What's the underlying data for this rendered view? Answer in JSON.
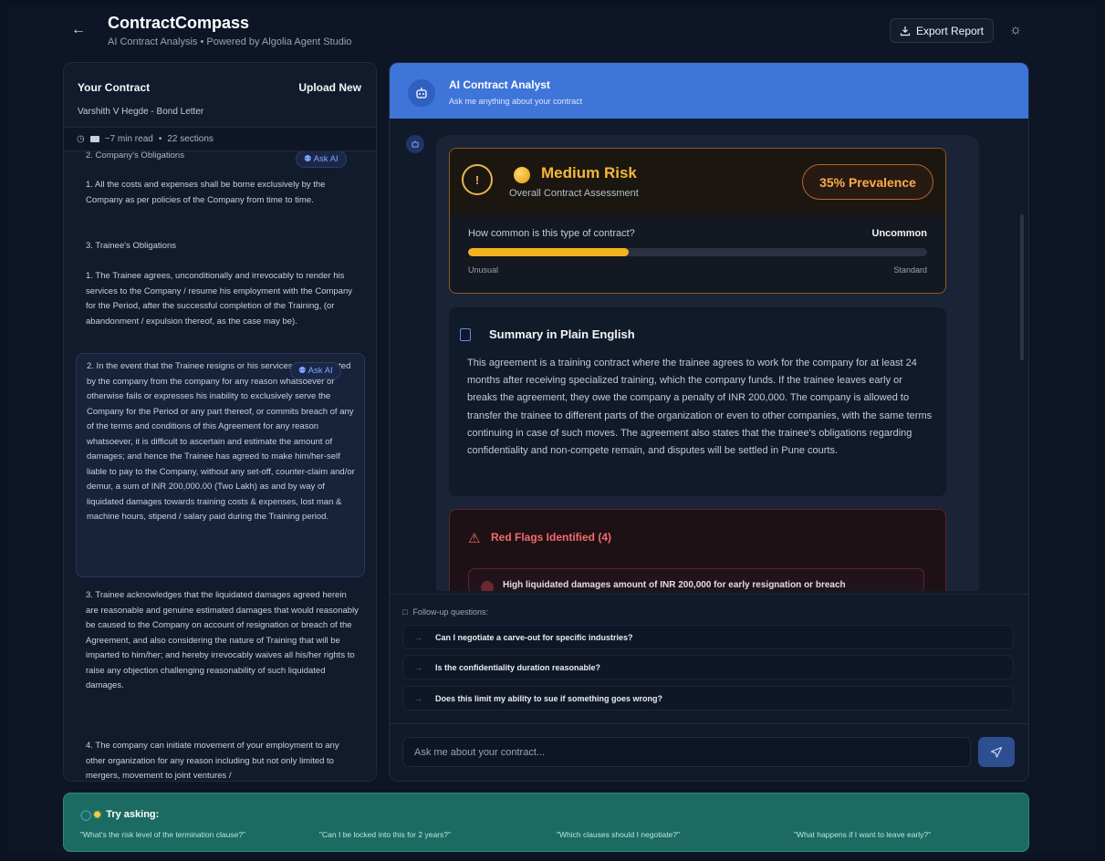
{
  "header": {
    "title": "ContractCompass",
    "subtitle": "AI Contract Analysis • Powered by Algolia Agent Studio",
    "export_label": "Export Report"
  },
  "contract_panel": {
    "title": "Your Contract",
    "upload_label": "Upload New",
    "document_name": "Varshith V Hegde - Bond Letter",
    "read_time": "~7 min read",
    "sections": "22 sections",
    "ask_ai_label": "Ask AI",
    "section_heading": "2. Company's Obligations",
    "para_costs": "1. All the costs and expenses shall be borne exclusively by the Company as per policies of the Company from time to time.",
    "heading_trainee": "3. Trainee's Obligations",
    "para_trainee_1": "1. The Trainee agrees, unconditionally and irrevocably to render his services to the Company / resume his employment with the Company for the Period, after the successful completion of the Training, (or abandonment / expulsion thereof, as the case may be).",
    "para_trainee_2": "2. In the event that the Trainee resigns or his services are terminated by the company from the company for any reason whatsoever or otherwise fails or expresses his inability to exclusively serve the Company for the Period or any part thereof, or commits breach of any of the terms and conditions of this Agreement for any reason whatsoever, it is difficult to ascertain and estimate the amount of damages; and hence the Trainee has agreed to make him/her-self liable to pay to the Company, without any set-off, counter-claim and/or demur, a sum of INR 200,000.00 (Two Lakh) as and by way of liquidated damages towards training costs & expenses, lost man & machine hours, stipend / salary paid during the Training period.",
    "para_trainee_3": "3. Trainee acknowledges that the liquidated damages agreed herein are reasonable and genuine estimated damages that would reasonably be caused to the Company on account of resignation or breach of the Agreement, and also considering the nature of Training that will be imparted to him/her; and hereby irrevocably waives all his/her rights to raise any objection challenging reasonability of such liquidated damages.",
    "para_trainee_4": "4. The company can initiate movement of your employment to any other organization for any reason including but not only limited to mergers, movement to joint ventures /"
  },
  "chat": {
    "title": "AI Contract Analyst",
    "subtitle": "Ask me anything about your contract",
    "risk": {
      "level": "Medium Risk",
      "label": "Overall Contract Assessment",
      "prevalence": "35% Prevalence",
      "question": "How common is this type of contract?",
      "answer": "Uncommon",
      "prevalence_fraction": 0.35,
      "scale_min": "Unusual",
      "scale_max": "Standard",
      "accent_color": "#f5b73a"
    },
    "summary": {
      "title": "Summary in Plain English",
      "text": "This agreement is a training contract where the trainee agrees to work for the company for at least 24 months after receiving specialized training, which the company funds. If the trainee leaves early or breaks the agreement, they owe the company a penalty of INR 200,000. The company is allowed to transfer the trainee to different parts of the organization or even to other companies, with the same terms continuing in case of such moves. The agreement also states that the trainee's obligations regarding confidentiality and non-compete remain, and disputes will be settled in Pune courts."
    },
    "red_flags": {
      "title": "Red Flags Identified (4)",
      "first_item": "High liquidated damages amount of INR 200,000 for early resignation or breach"
    },
    "followup": {
      "label": "Follow-up questions:",
      "items": [
        "Can I negotiate a carve-out for specific industries?",
        "Is the confidentiality duration reasonable?",
        "Does this limit my ability to sue if something goes wrong?"
      ]
    },
    "input_placeholder": "Ask me about your contract..."
  },
  "tips": {
    "title": "Try asking:",
    "items": [
      "\"What's the risk level of the termination clause?\"",
      "\"Can I be locked into this for 2 years?\"",
      "\"Which clauses should I negotiate?\"",
      "\"What happens if I want to leave early?\""
    ]
  }
}
